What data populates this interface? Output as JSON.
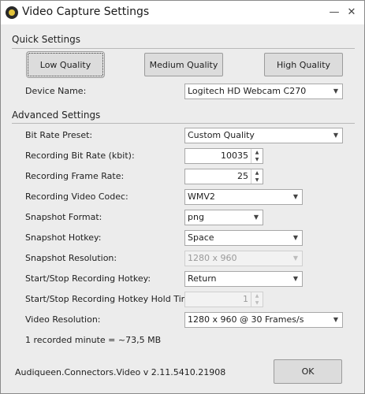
{
  "window": {
    "title": "Video Capture Settings"
  },
  "quick": {
    "title": "Quick Settings",
    "buttons": [
      "Low Quality",
      "Medium Quality",
      "High Quality"
    ],
    "device_label": "Device Name:",
    "device_value": "Logitech HD Webcam C270"
  },
  "advanced": {
    "title": "Advanced Settings",
    "bitrate_preset_label": "Bit Rate Preset:",
    "bitrate_preset_value": "Custom Quality",
    "bitrate_label": "Recording Bit Rate (kbit):",
    "bitrate_value": "10035",
    "framerate_label": "Recording Frame Rate:",
    "framerate_value": "25",
    "codec_label": "Recording Video Codec:",
    "codec_value": "WMV2",
    "snap_format_label": "Snapshot Format:",
    "snap_format_value": "png",
    "snap_hotkey_label": "Snapshot Hotkey:",
    "snap_hotkey_value": "Space",
    "snap_res_label": "Snapshot Resolution:",
    "snap_res_value": "1280 x 960",
    "rec_hotkey_label": "Start/Stop Recording Hotkey:",
    "rec_hotkey_value": "Return",
    "hold_label": "Start/Stop Recording Hotkey Hold Time:",
    "hold_value": "1",
    "vres_label": "Video Resolution:",
    "vres_value": "1280 x 960 @ 30 Frames/s"
  },
  "info": "1 recorded minute = ~73,5 MB",
  "version": "Audiqueen.Connectors.Video v 2.11.5410.21908",
  "ok_label": "OK"
}
